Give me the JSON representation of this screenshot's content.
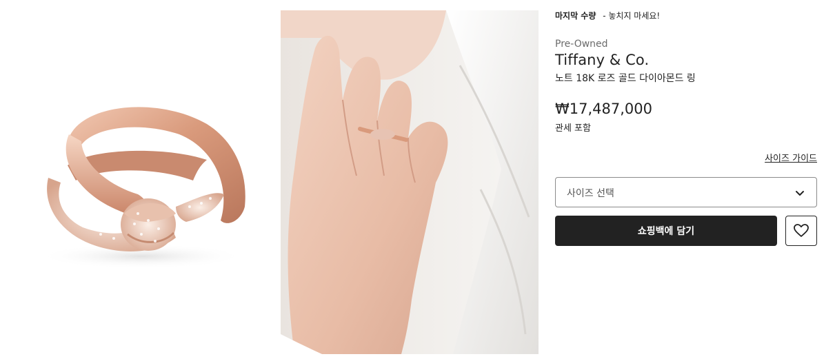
{
  "urgency": {
    "label": "마지막 수량",
    "message": "- 놓치지 마세요!"
  },
  "product": {
    "condition": "Pre-Owned",
    "brand": "Tiffany & Co.",
    "name": "노트 18K 로즈 골드 다이아몬드 링",
    "price": "₩17,487,000",
    "tax_note": "관세 포함"
  },
  "size": {
    "guide_label": "사이즈 가이드",
    "select_placeholder": "사이즈 선택"
  },
  "actions": {
    "add_to_bag": "쇼핑백에 담기"
  },
  "icons": {
    "size_chevron": "chevron-down-icon",
    "wishlist": "heart-icon"
  },
  "colors": {
    "primary_button": "#222222",
    "ring_rose_gold": "#d9a58a",
    "background": "#ffffff"
  }
}
